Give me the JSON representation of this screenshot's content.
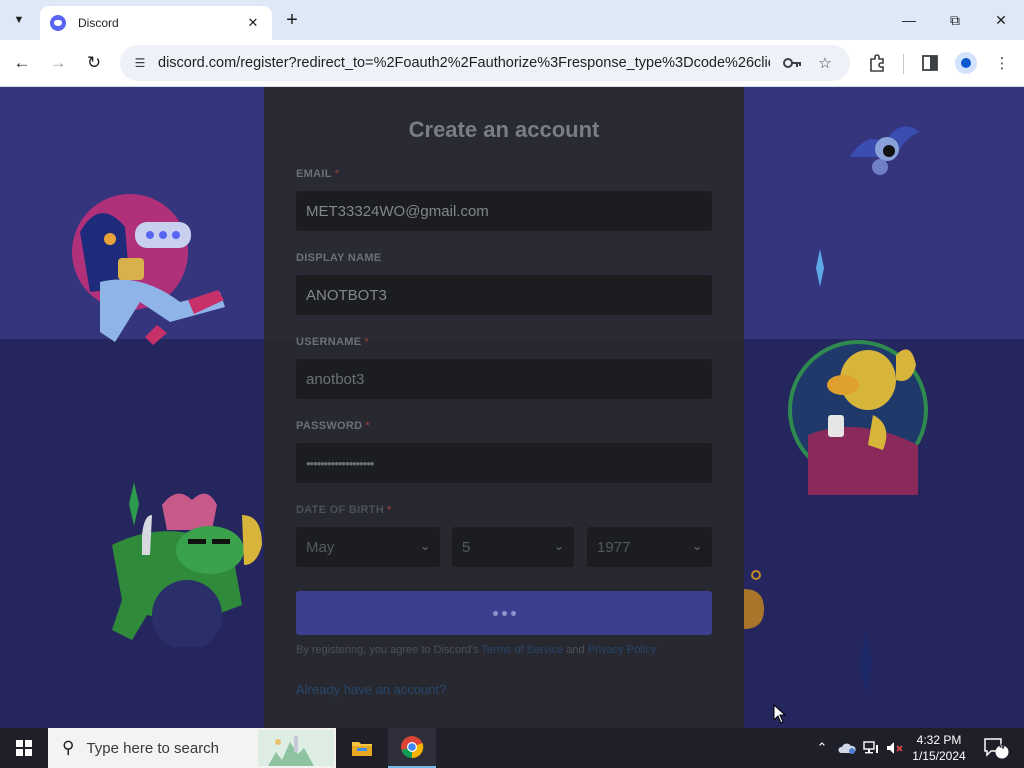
{
  "browser": {
    "tab": {
      "title": "Discord",
      "favicon": "discord-icon"
    },
    "address_bar": {
      "url": "discord.com/register?redirect_to=%2Foauth2%2Fauthorize%3Fresponse_type%3Dcode%26client_i..."
    },
    "icons": [
      "tab-search-icon",
      "close-icon",
      "plus-icon",
      "minimize-icon",
      "restore-icon",
      "back-arrow-icon",
      "forward-arrow-icon",
      "reload-icon",
      "site-info-icon",
      "key-icon",
      "star-icon",
      "extensions-icon",
      "side-panel-icon",
      "profile-icon",
      "kebab-menu-icon"
    ]
  },
  "form": {
    "title": "Create an account",
    "email": {
      "label": "EMAIL",
      "value": "MET33324WO@gmail.com",
      "required_marker": "*"
    },
    "display_name": {
      "label": "DISPLAY NAME",
      "value": "ANOTBOT3"
    },
    "username": {
      "label": "USERNAME",
      "value": "anotbot3",
      "required_marker": "*"
    },
    "password": {
      "label": "PASSWORD",
      "value": "•••••••••••••••••••",
      "required_marker": "*"
    },
    "date_of_birth": {
      "label": "DATE OF BIRTH",
      "required_marker": "*",
      "month": "May",
      "day": "5",
      "year": "1977"
    },
    "continue_button": {
      "state": "loading"
    },
    "terms": {
      "prefix": "By registering, you agree to Discord's",
      "tos": "Terms of Service",
      "and": "and",
      "privacy": "Privacy Policy"
    },
    "login_link": "Already have an account?"
  },
  "taskbar": {
    "search_placeholder": "Type here to search",
    "apps": [
      "file-explorer-icon",
      "chrome-icon"
    ],
    "clock": {
      "time": "4:32 PM",
      "date": "1/15/2024"
    },
    "notification_count": "4"
  },
  "colors": {
    "blurple": "#5865f2",
    "page_background": "#34357d",
    "modal_background": "#28292d",
    "taskbar": "#1f1f2a"
  }
}
